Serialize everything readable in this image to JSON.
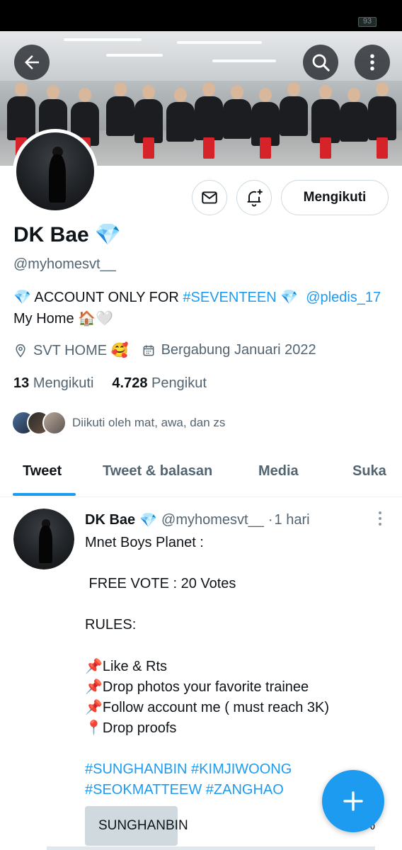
{
  "status_bar": {
    "battery": "93"
  },
  "header": {
    "back_icon": "arrow-left-icon",
    "search_icon": "search-icon",
    "more_icon": "more-vertical-icon"
  },
  "profile": {
    "name": "DK Bae",
    "name_badge": "💎",
    "handle": "@myhomesvt__",
    "follow_label": "Mengikuti",
    "message_icon": "mail-icon",
    "notify_icon": "bell-plus-icon",
    "bio": {
      "line1_prefix": "💎 ACCOUNT ONLY FOR ",
      "hashtag": "#SEVENTEEN",
      "line1_mid": " 💎  ",
      "mention": "@pledis_17",
      "line2": "My Home 🏠🤍"
    },
    "location": "SVT HOME 🥰",
    "joined": "Bergabung Januari 2022",
    "following_count": "13",
    "following_label": "Mengikuti",
    "followers_count": "4.728",
    "followers_label": "Pengikut",
    "followed_by": "Diikuti oleh mat, awa, dan zs"
  },
  "tabs": [
    {
      "label": "Tweet",
      "active": true
    },
    {
      "label": "Tweet & balasan",
      "active": false
    },
    {
      "label": "Media",
      "active": false
    },
    {
      "label": "Suka",
      "active": false
    }
  ],
  "tweet": {
    "author_name": "DK Bae",
    "badge": "💎",
    "author_handle": "@myhomesvt__",
    "separator": "·",
    "time": "1 hari",
    "body": "Mnet Boys Planet :\n\n FREE VOTE : 20 Votes\n\nRULES:\n\n📌Like & Rts\n📌Drop photos your favorite trainee\n📌Follow account me ( must reach 3K)\n📍Drop proofs",
    "hashtags": [
      "#SUNGHANBIN",
      "#KIMJIWOONG",
      "#SEOKMATTEEW",
      "#ZANGHAO"
    ],
    "poll": {
      "option": "SUNGHANBIN",
      "percent_text": "34%",
      "fill_fraction": 0.32
    }
  },
  "fab": {
    "icon": "plus-icon"
  },
  "colors": {
    "accent": "#1d9bf0",
    "text": "#0f1419",
    "muted": "#536471",
    "border": "#cfd9de"
  }
}
